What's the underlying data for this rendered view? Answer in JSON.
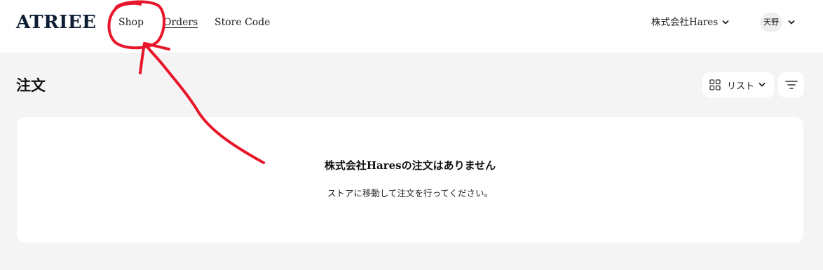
{
  "header": {
    "logo": "ATRIEE",
    "nav": [
      {
        "label": "Shop"
      },
      {
        "label": "Orders"
      },
      {
        "label": "Store Code"
      }
    ],
    "company": "株式会社Hares",
    "user_avatar": "天野"
  },
  "main": {
    "title": "注文",
    "view_toggle": {
      "label": "リスト",
      "icon": "grid-icon"
    },
    "filter_icon": "filter-icon",
    "empty_state": {
      "title": "株式会社Haresの注文はありません",
      "subtitle": "ストアに移動して注文を行ってください。"
    }
  },
  "annotation": {
    "color": "#e8162b",
    "shapes": [
      "circle",
      "arrow"
    ]
  }
}
